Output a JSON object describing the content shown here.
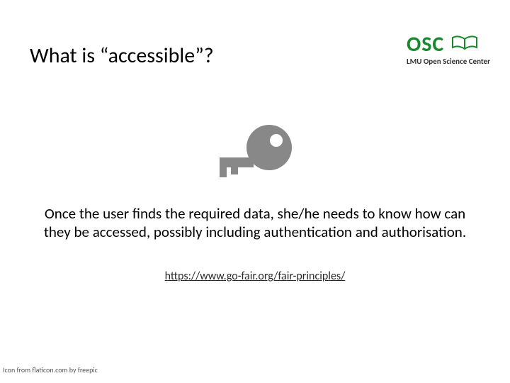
{
  "title": "What is “accessible”?",
  "logo": {
    "acronym": "OSC",
    "subtitle": "LMU Open Science Center"
  },
  "body": "Once the user finds the required data, she/he needs to know how can they be accessed, possibly including authentication and authorisation.",
  "link": "https://www.go-fair.org/fair-principles/",
  "credit": "Icon from flaticon.com by freepic"
}
